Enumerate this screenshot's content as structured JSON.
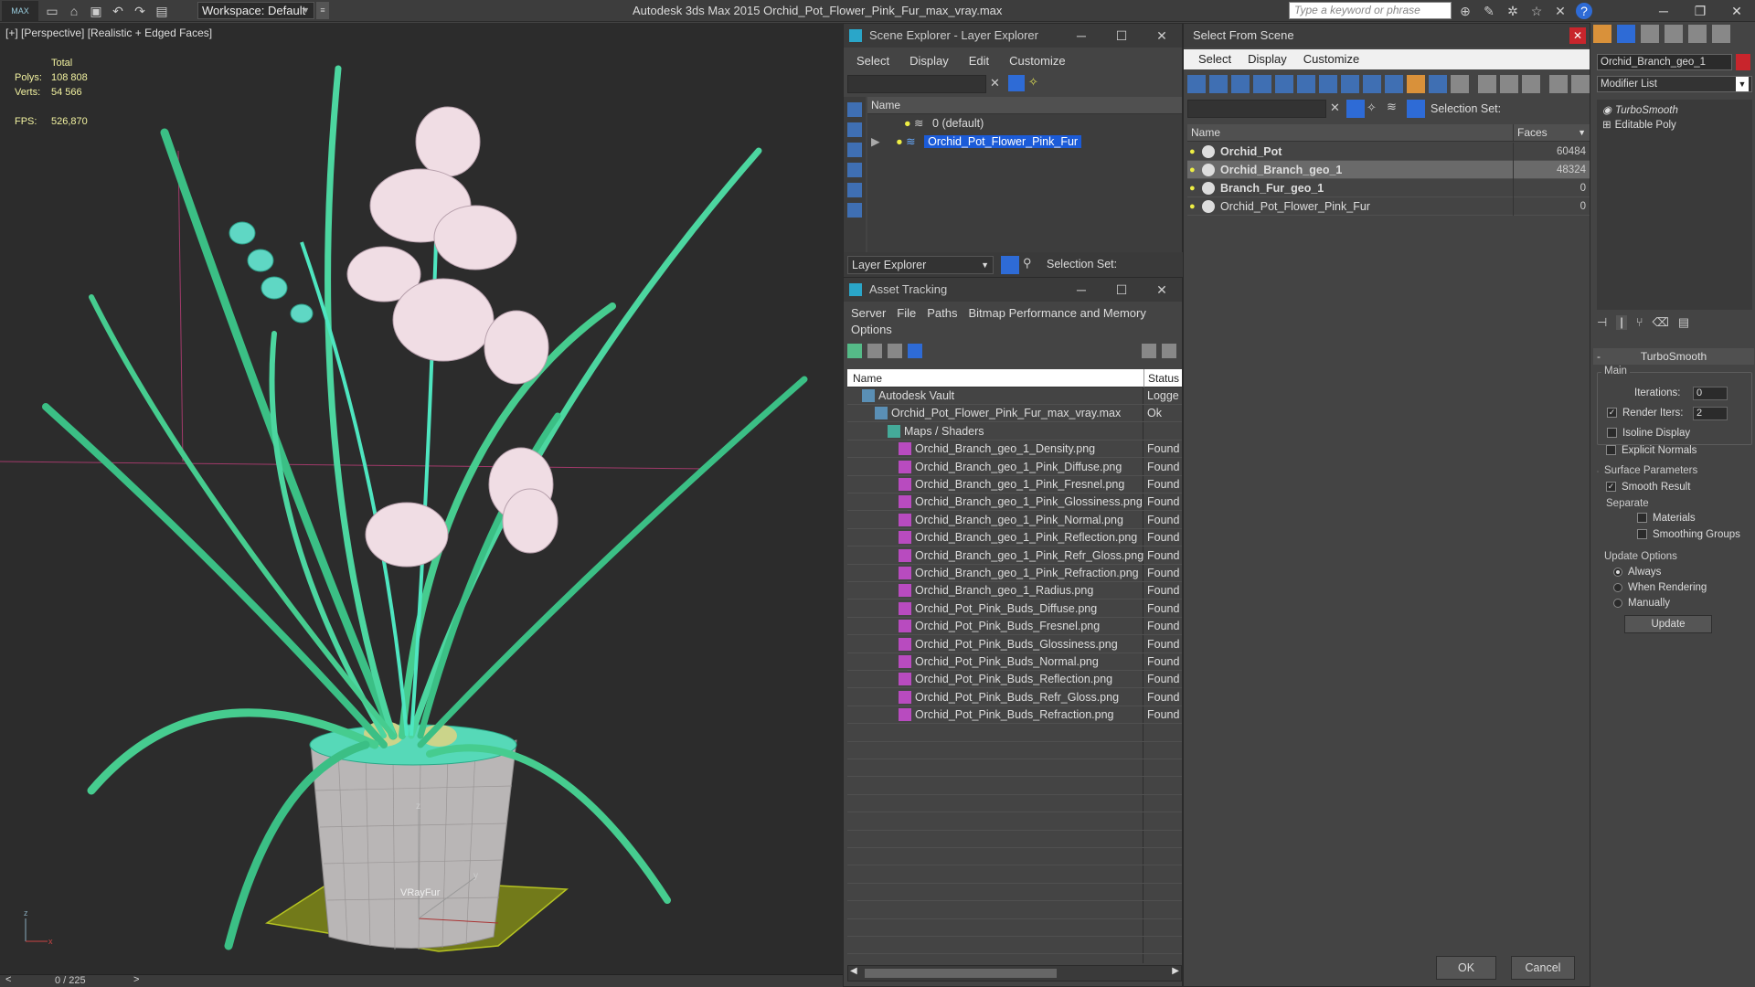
{
  "app": {
    "logo": "MAX",
    "title": "Autodesk 3ds Max  2015    Orchid_Pot_Flower_Pink_Fur_max_vray.max",
    "workspace_label": "Workspace: Default",
    "search_placeholder": "Type a keyword or phrase"
  },
  "viewport": {
    "label": "[+] [Perspective] [Realistic + Edged Faces]",
    "stats_total": "Total",
    "polys_label": "Polys:",
    "polys_value": "108 808",
    "verts_label": "Verts:",
    "verts_value": "54 566",
    "fps_label": "FPS:",
    "fps_value": "526,870",
    "vrayfur_label": "VRayFur",
    "axis_z": "z",
    "axis_y": "y",
    "axis_x": "x"
  },
  "timeline": {
    "frame": "0 / 225"
  },
  "scene_explorer": {
    "title": "Scene Explorer - Layer Explorer",
    "menu": [
      "Select",
      "Display",
      "Edit",
      "Customize"
    ],
    "col_name": "Name",
    "rows": [
      "0 (default)",
      "Orchid_Pot_Flower_Pink_Fur"
    ],
    "footer_mode": "Layer Explorer",
    "selection_set_label": "Selection Set:"
  },
  "asset_tracking": {
    "title": "Asset Tracking",
    "menu": [
      "Server",
      "File",
      "Paths",
      "Bitmap Performance and Memory"
    ],
    "menu2": "Options",
    "col_name": "Name",
    "col_status": "Status",
    "rows": [
      {
        "name": "Autodesk Vault",
        "status": "Logge",
        "indent": 0
      },
      {
        "name": "Orchid_Pot_Flower_Pink_Fur_max_vray.max",
        "status": "Ok",
        "indent": 1
      },
      {
        "name": "Maps / Shaders",
        "status": "",
        "indent": 2
      },
      {
        "name": "Orchid_Branch_geo_1_Density.png",
        "status": "Found",
        "indent": 3
      },
      {
        "name": "Orchid_Branch_geo_1_Pink_Diffuse.png",
        "status": "Found",
        "indent": 3
      },
      {
        "name": "Orchid_Branch_geo_1_Pink_Fresnel.png",
        "status": "Found",
        "indent": 3
      },
      {
        "name": "Orchid_Branch_geo_1_Pink_Glossiness.png",
        "status": "Found",
        "indent": 3
      },
      {
        "name": "Orchid_Branch_geo_1_Pink_Normal.png",
        "status": "Found",
        "indent": 3
      },
      {
        "name": "Orchid_Branch_geo_1_Pink_Reflection.png",
        "status": "Found",
        "indent": 3
      },
      {
        "name": "Orchid_Branch_geo_1_Pink_Refr_Gloss.png",
        "status": "Found",
        "indent": 3
      },
      {
        "name": "Orchid_Branch_geo_1_Pink_Refraction.png",
        "status": "Found",
        "indent": 3
      },
      {
        "name": "Orchid_Branch_geo_1_Radius.png",
        "status": "Found",
        "indent": 3
      },
      {
        "name": "Orchid_Pot_Pink_Buds_Diffuse.png",
        "status": "Found",
        "indent": 3
      },
      {
        "name": "Orchid_Pot_Pink_Buds_Fresnel.png",
        "status": "Found",
        "indent": 3
      },
      {
        "name": "Orchid_Pot_Pink_Buds_Glossiness.png",
        "status": "Found",
        "indent": 3
      },
      {
        "name": "Orchid_Pot_Pink_Buds_Normal.png",
        "status": "Found",
        "indent": 3
      },
      {
        "name": "Orchid_Pot_Pink_Buds_Reflection.png",
        "status": "Found",
        "indent": 3
      },
      {
        "name": "Orchid_Pot_Pink_Buds_Refr_Gloss.png",
        "status": "Found",
        "indent": 3
      },
      {
        "name": "Orchid_Pot_Pink_Buds_Refraction.png",
        "status": "Found",
        "indent": 3
      }
    ]
  },
  "select_from_scene": {
    "title": "Select From Scene",
    "menu": [
      "Select",
      "Display",
      "Customize"
    ],
    "selection_set_label": "Selection Set:",
    "col_name": "Name",
    "col_faces": "Faces",
    "rows": [
      {
        "name": "Orchid_Pot",
        "faces": "60484",
        "bold": true,
        "selected": false
      },
      {
        "name": "Orchid_Branch_geo_1",
        "faces": "48324",
        "bold": true,
        "selected": true
      },
      {
        "name": "Branch_Fur_geo_1",
        "faces": "0",
        "bold": true,
        "selected": false
      },
      {
        "name": "Orchid_Pot_Flower_Pink_Fur",
        "faces": "0",
        "bold": false,
        "selected": false
      }
    ],
    "ok_label": "OK",
    "cancel_label": "Cancel"
  },
  "command_panel": {
    "object_name": "Orchid_Branch_geo_1",
    "modifier_list_label": "Modifier List",
    "stack": [
      "TurboSmooth",
      "Editable Poly"
    ],
    "rollout_title": "TurboSmooth",
    "main_label": "Main",
    "iterations_label": "Iterations:",
    "iterations_value": "0",
    "render_iters_label": "Render Iters:",
    "render_iters_value": "2",
    "isoline_label": "Isoline Display",
    "explicit_normals_label": "Explicit Normals",
    "surface_params_label": "Surface Parameters",
    "smooth_result_label": "Smooth Result",
    "separate_label": "Separate",
    "materials_label": "Materials",
    "smoothing_groups_label": "Smoothing Groups",
    "update_options_label": "Update Options",
    "always_label": "Always",
    "when_rendering_label": "When Rendering",
    "manually_label": "Manually",
    "update_button": "Update"
  },
  "colors": {
    "wire_green": "#4ee6c0",
    "pot_grey": "#b9b6b6",
    "petal_pink": "#f0dde4",
    "selection_blue": "#1b5bd8",
    "accent_red": "#c8252c"
  }
}
